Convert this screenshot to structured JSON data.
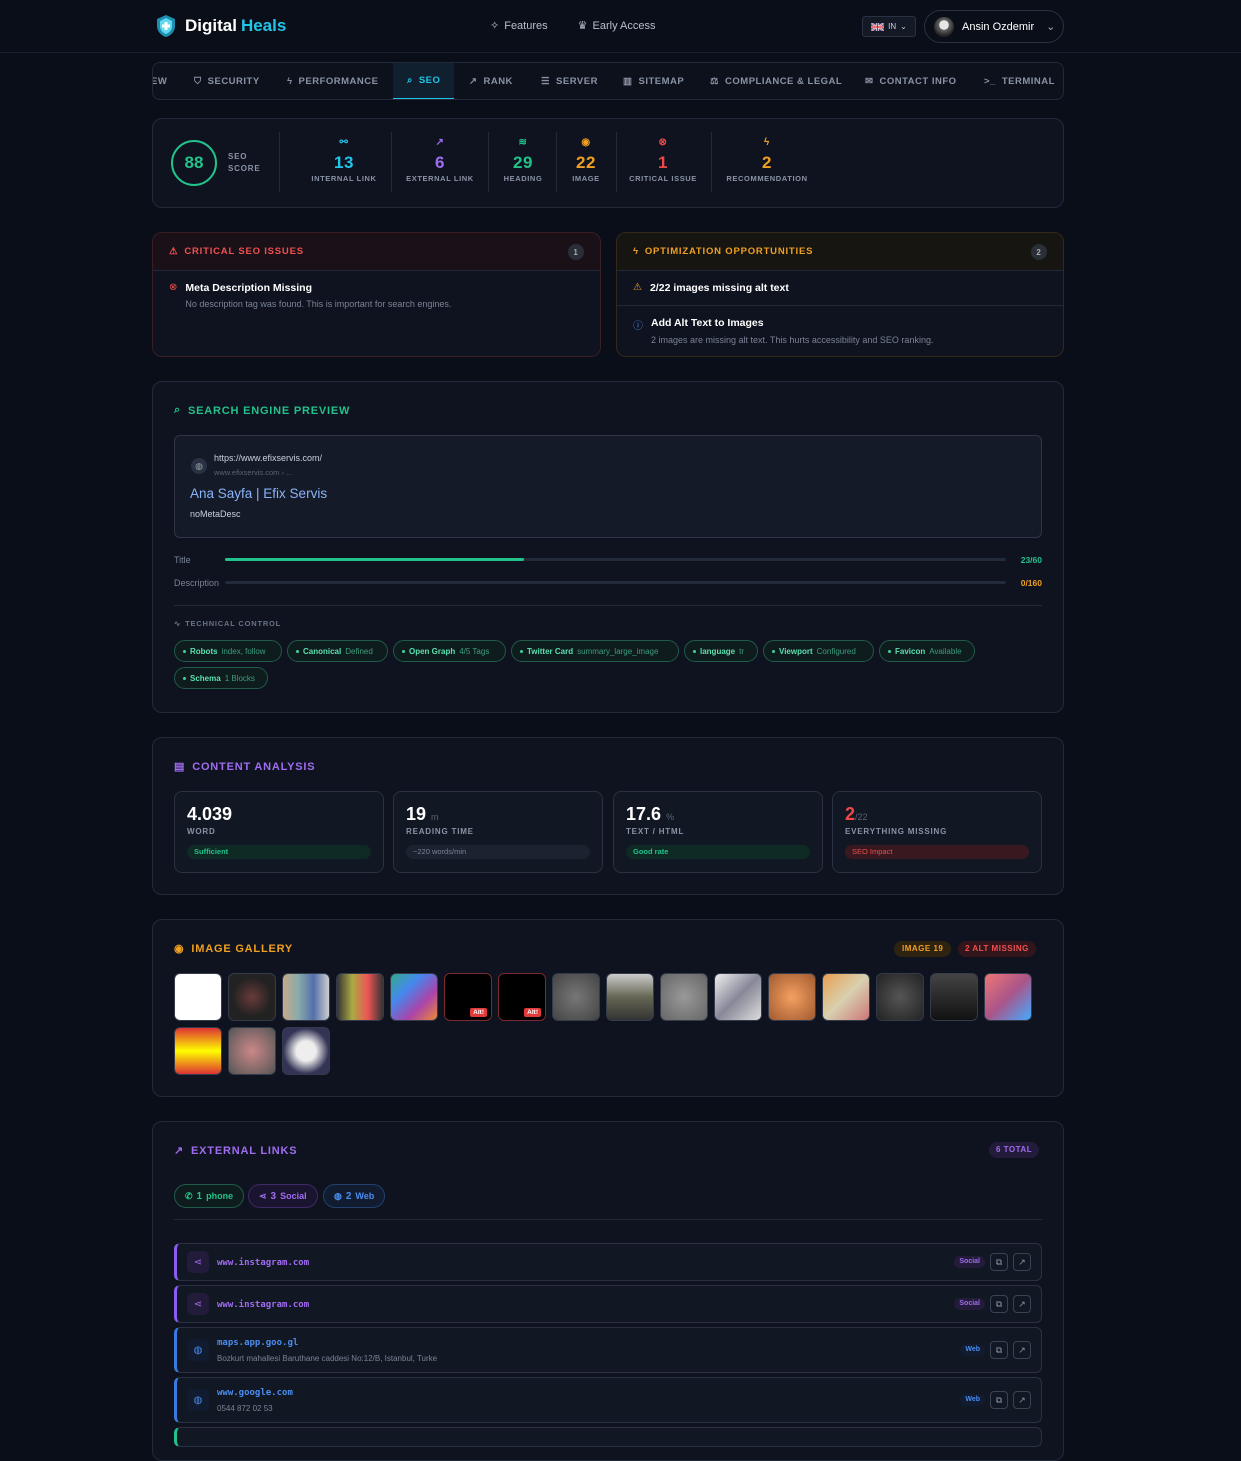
{
  "header": {
    "brand_1": "Digital",
    "brand_2": "Heals",
    "nav": [
      {
        "label": "Features"
      },
      {
        "label": "Early Access"
      }
    ],
    "lang": "IN",
    "user": "Ansin Ozdemir"
  },
  "tabs": [
    {
      "label": "EW"
    },
    {
      "label": "SECURITY"
    },
    {
      "label": "PERFORMANCE"
    },
    {
      "label": "SEO"
    },
    {
      "label": "RANK"
    },
    {
      "label": "SERVER"
    },
    {
      "label": "SITEMAP"
    },
    {
      "label": "COMPLIANCE & LEGAL"
    },
    {
      "label": "CONTACT INFO"
    },
    {
      "label": "TERMINAL"
    }
  ],
  "summary": {
    "score": "88",
    "score_label_1": "SEO",
    "score_label_2": "SCORE",
    "stats": [
      {
        "value": "13",
        "label": "INTERNAL LINK",
        "color": "#22c5e8"
      },
      {
        "value": "6",
        "label": "EXTERNAL LINK",
        "color": "#a06cf0"
      },
      {
        "value": "29",
        "label": "HEADING",
        "color": "#23c28a"
      },
      {
        "value": "22",
        "label": "IMAGE",
        "color": "#f0a020"
      },
      {
        "value": "1",
        "label": "CRITICAL ISSUE",
        "color": "#f04848"
      },
      {
        "value": "2",
        "label": "RECOMMENDATION",
        "color": "#f0a020"
      }
    ]
  },
  "critical": {
    "title": "CRITICAL SEO ISSUES",
    "count": "1",
    "items": [
      {
        "title": "Meta Description Missing",
        "desc": "No description tag was found. This is important for search engines."
      }
    ]
  },
  "opportunities": {
    "title": "OPTIMIZATION OPPORTUNITIES",
    "count": "2",
    "items": [
      {
        "title": "2/22 images missing alt text",
        "desc": ""
      },
      {
        "title": "Add Alt Text to Images",
        "desc": "2 images are missing alt text. This hurts accessibility and SEO ranking."
      }
    ]
  },
  "preview": {
    "title": "SEARCH ENGINE PREVIEW",
    "url": "https://www.efixservis.com/",
    "crumb": "www.efixservis.com › ...",
    "page_title": "Ana Sayfa | Efix Servis",
    "desc": "noMetaDesc",
    "title_label": "Title",
    "title_count": "23/60",
    "title_ratio": 0.383,
    "desc_label": "Description",
    "desc_count": "0/160",
    "desc_ratio": 0,
    "tech_title": "TECHNICAL CONTROL",
    "tech": [
      {
        "k": "Robots",
        "v": "index, follow"
      },
      {
        "k": "Canonical",
        "v": "Defined"
      },
      {
        "k": "Open Graph",
        "v": "4/5 Tags"
      },
      {
        "k": "Twitter Card",
        "v": "summary_large_image"
      },
      {
        "k": "language",
        "v": "tr"
      },
      {
        "k": "Viewport",
        "v": "Configured"
      },
      {
        "k": "Favicon",
        "v": "Available"
      },
      {
        "k": "Schema",
        "v": "1 Blocks"
      }
    ]
  },
  "content": {
    "title": "CONTENT ANALYSIS",
    "cards": [
      {
        "value": "4.039",
        "unit": "",
        "label": "WORD",
        "tag": "Sufficient"
      },
      {
        "value": "19",
        "unit": "m",
        "label": "READING TIME",
        "tag": "~220 words/min"
      },
      {
        "value": "17.6",
        "unit": "%",
        "label": "TEXT / HTML",
        "tag": "Good rate"
      },
      {
        "value": "2",
        "unit": "/22",
        "label": "EVERYTHING MISSING",
        "tag": "SEO Impact"
      }
    ]
  },
  "gallery": {
    "title": "IMAGE GALLERY",
    "badge_count": "IMAGE 19",
    "badge_missing": "2 ALT MISSING",
    "alt_label": "Alt!"
  },
  "links": {
    "title": "EXTERNAL LINKS",
    "total": "6 TOTAL",
    "filters": [
      {
        "n": "1",
        "l": "phone"
      },
      {
        "n": "3",
        "l": "Social"
      },
      {
        "n": "2",
        "l": "Web"
      }
    ],
    "rows": [
      {
        "url": "www.instagram.com",
        "sub": "",
        "type": "Social"
      },
      {
        "url": "www.instagram.com",
        "sub": "",
        "type": "Social"
      },
      {
        "url": "maps.app.goo.gl",
        "sub": "Bozkurt mahallesi Baruthane caddesi No:12/B, Istanbul, Turke",
        "type": "Web"
      },
      {
        "url": "www.google.com",
        "sub": "0544 872 02 53",
        "type": "Web"
      }
    ]
  }
}
